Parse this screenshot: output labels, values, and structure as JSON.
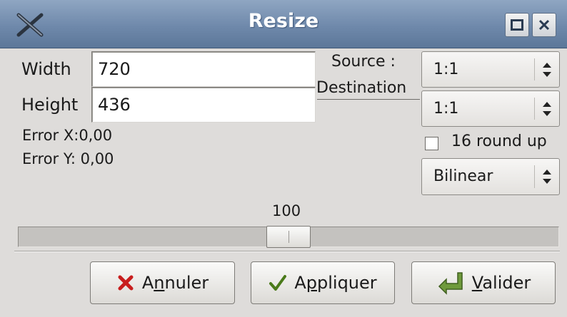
{
  "window": {
    "title": "Resize",
    "app_icon": "x-icon",
    "maximize_icon": "square-icon",
    "close_icon": "close-icon"
  },
  "dimensions": {
    "width_label": "Width",
    "width_value": "720",
    "height_label": "Height",
    "height_value": "436"
  },
  "errors": {
    "error_x": "Error X:0,00",
    "error_y": "Error Y: 0,00"
  },
  "aspect": {
    "source_label": "Source :",
    "destination_label": "Destination",
    "source_ratio": "1:1",
    "destination_ratio": "1:1"
  },
  "round_up": {
    "label": "16 round up",
    "checked": false
  },
  "filter": {
    "selected": "Bilinear"
  },
  "scale": {
    "value_label": "100",
    "value": 100
  },
  "buttons": {
    "cancel": {
      "before": "A",
      "mnemonic": "n",
      "after": "nuler",
      "icon": "red-x-icon"
    },
    "apply": {
      "before": "A",
      "mnemonic": "p",
      "after": "pliquer",
      "icon": "checkmark-icon"
    },
    "ok": {
      "before": "",
      "mnemonic": "V",
      "after": "alider",
      "icon": "enter-arrow-icon"
    }
  },
  "colors": {
    "titlebar": "#6f89ab",
    "background": "#dedcda",
    "cancel_icon": "#c81e1e",
    "apply_icon": "#4a7a1a",
    "ok_icon": "#5b8a2c"
  }
}
